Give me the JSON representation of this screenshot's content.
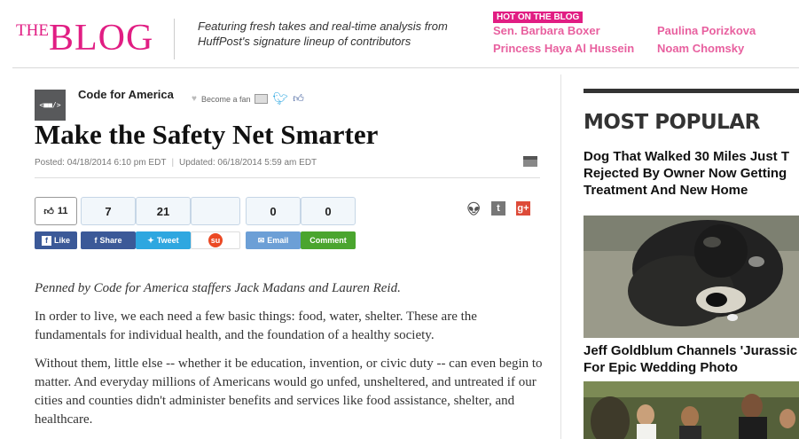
{
  "header": {
    "logo_the": "THE",
    "logo_blog": "BLOG",
    "tagline": "Featuring fresh takes and real-time analysis from HuffPost's signature lineup of contributors",
    "hot_label": "HOT ON THE BLOG",
    "hot_links": [
      "Sen. Barbara Boxer",
      "Paulina Porizkova",
      "Princess Haya Al Hussein",
      "Noam Chomsky"
    ],
    "accent_color": "#e11d83"
  },
  "article": {
    "avatar_text": "<■■/>",
    "author": "Code for America",
    "become_fan": "Become a fan",
    "title": "Make the Safety Net Smarter",
    "posted": "Posted: 04/18/2014 6:10 pm EDT",
    "updated": "Updated: 06/18/2014 5:59 am EDT",
    "shares": [
      {
        "count": "11",
        "label": "Like",
        "color": "#3b5998",
        "icon": "thumbs-up-icon"
      },
      {
        "count": "7",
        "label": "Share",
        "color": "#3b5998",
        "icon": "facebook-icon"
      },
      {
        "count": "21",
        "label": "Tweet",
        "color": "#2ea7e0",
        "icon": "twitter-icon"
      },
      {
        "count": "",
        "label": "",
        "color": "#eb4924",
        "icon": "stumbleupon-icon"
      },
      {
        "count": "0",
        "label": "Email",
        "color": "#6c9fd6",
        "icon": "email-icon"
      },
      {
        "count": "0",
        "label": "Comment",
        "color": "#4aa52e",
        "icon": "comment-icon"
      }
    ],
    "social_right_icons": [
      "reddit-icon",
      "tumblr-icon",
      "google-plus-icon"
    ],
    "paragraphs": [
      "Penned by Code for America staffers Jack Madans and Lauren Reid.",
      "In order to live, we each need a few basic things: food, water, shelter. These are the fundamentals for individual health, and the foundation of a healthy society.",
      "Without them, little else -- whether it be education, invention, or civic duty -- can even begin to matter. And everyday millions of Americans would go unfed, unsheltered, and untreated if our cities and counties didn't administer benefits and services like food assistance, shelter, and healthcare."
    ]
  },
  "sidebar": {
    "heading": "MOST POPULAR",
    "stories": [
      "Dog That Walked 30 Miles Just T Rejected By Owner Now Getting Treatment And New Home",
      "Jeff Goldblum Channels 'Jurassic For Epic Wedding Photo"
    ]
  }
}
